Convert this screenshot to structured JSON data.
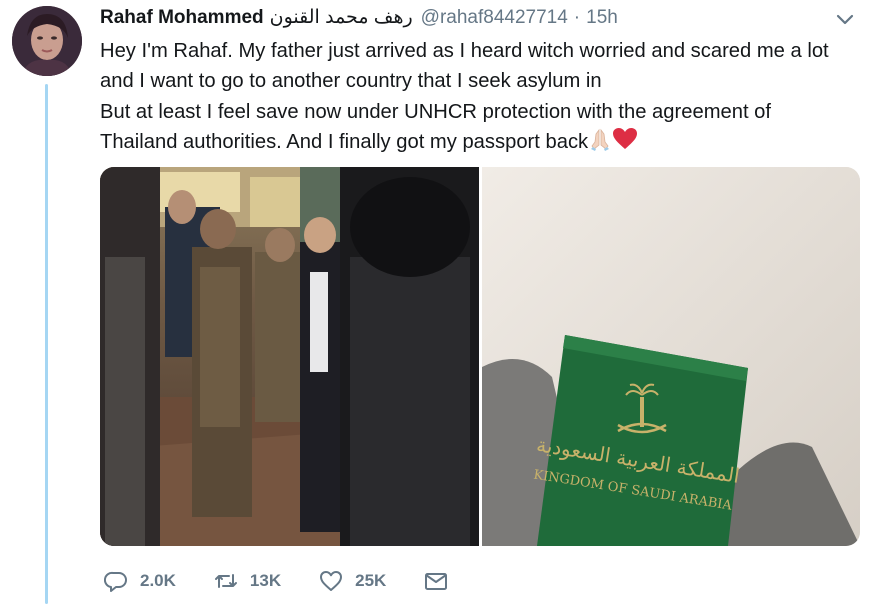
{
  "tweet": {
    "display_name": "Rahaf Mohammed",
    "display_name_ar": "رهف محمد القنون",
    "handle": "@rahaf84427714",
    "separator": "·",
    "time": "15h",
    "text_lines": [
      "Hey I'm Rahaf. My father just arrived as I heard witch worried and scared me a lot",
      "and I want to go to another country that I seek asylum in",
      "But at least I feel save now under UNHCR protection with the agreement of",
      "Thailand authorities. And I finally got my passport back"
    ],
    "text_emojis": [
      "folded-hands-emoji",
      "red-heart-emoji"
    ]
  },
  "media": {
    "photos": [
      {
        "name": "officials-photo"
      },
      {
        "name": "passport-photo",
        "passport_title": "KINGDOM OF SAUDI ARABIA"
      }
    ]
  },
  "actions": {
    "reply_count": "2.0K",
    "retweet_count": "13K",
    "like_count": "25K"
  },
  "colors": {
    "thread_line": "#a5d6f3",
    "secondary_text": "#657786",
    "primary_text": "#14171a",
    "heart_red": "#e0245e",
    "passport_green": "#1f6b3a"
  },
  "icons": [
    "chevron-down-icon",
    "reply-icon",
    "retweet-icon",
    "like-icon",
    "message-icon"
  ]
}
